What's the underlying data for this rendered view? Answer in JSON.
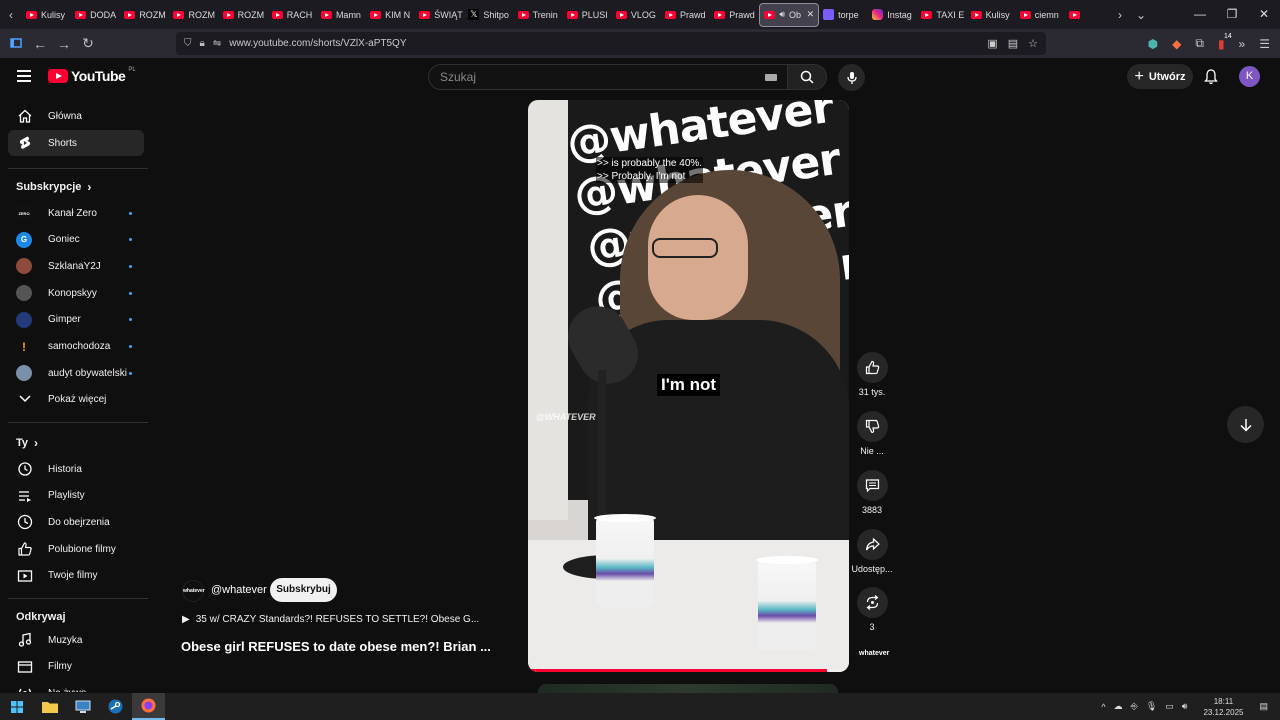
{
  "browser": {
    "tabs": [
      {
        "label": "Kulisy",
        "icon": "youtube"
      },
      {
        "label": "DODA",
        "icon": "youtube"
      },
      {
        "label": "ROZM",
        "icon": "youtube"
      },
      {
        "label": "ROZM",
        "icon": "youtube"
      },
      {
        "label": "ROZM",
        "icon": "youtube"
      },
      {
        "label": "RACH",
        "icon": "youtube"
      },
      {
        "label": "Mamn",
        "icon": "youtube"
      },
      {
        "label": "KIM N",
        "icon": "youtube"
      },
      {
        "label": "ŚWIĄT",
        "icon": "youtube"
      },
      {
        "label": "Shitpo",
        "icon": "x"
      },
      {
        "label": "Trenin",
        "icon": "youtube"
      },
      {
        "label": "PLUSI",
        "icon": "youtube"
      },
      {
        "label": "VLOG",
        "icon": "youtube"
      },
      {
        "label": "Prawd",
        "icon": "youtube"
      },
      {
        "label": "Prawd",
        "icon": "youtube"
      },
      {
        "label": "Ob",
        "icon": "youtube",
        "active": true
      },
      {
        "label": "torpe",
        "icon": "t"
      },
      {
        "label": "Instag",
        "icon": "instagram"
      },
      {
        "label": "TAXI E",
        "icon": "youtube"
      },
      {
        "label": "Kulisy",
        "icon": "youtube"
      },
      {
        "label": "ciemn",
        "icon": "youtube"
      },
      {
        "label": "",
        "icon": "youtube"
      }
    ],
    "url": "www.youtube.com/shorts/VZlX-aPT5QY",
    "extension_badge": "14"
  },
  "header": {
    "logo_text": "YouTube",
    "logo_country": "PL",
    "search_placeholder": "Szukaj",
    "create_label": "Utwórz",
    "avatar_letter": "K"
  },
  "sidebar": {
    "main": [
      {
        "label": "Główna",
        "icon": "home-icon"
      },
      {
        "label": "Shorts",
        "icon": "shorts-icon",
        "active": true
      }
    ],
    "subscriptions_title": "Subskrypcje",
    "subscriptions": [
      {
        "label": "Kanał Zero",
        "avatar": "ZERO",
        "color": "#111111"
      },
      {
        "label": "Goniec",
        "avatar": "G",
        "color": "#1e88e5"
      },
      {
        "label": "SzklanaY2J",
        "avatar": "",
        "color": "#8d4b3c"
      },
      {
        "label": "Konopskyy",
        "avatar": "",
        "color": "#555555"
      },
      {
        "label": "Gimper",
        "avatar": "",
        "color": "#243a7a"
      },
      {
        "label": "samochodoza",
        "avatar": "!",
        "color": "#f2a900"
      },
      {
        "label": "audyt obywatelski",
        "avatar": "",
        "color": "#7a8fa8"
      }
    ],
    "show_more": "Pokaż więcej",
    "you_title": "Ty",
    "you_items": [
      {
        "label": "Historia",
        "icon": "history-icon"
      },
      {
        "label": "Playlisty",
        "icon": "playlist-icon"
      },
      {
        "label": "Do obejrzenia",
        "icon": "watch-later-icon"
      },
      {
        "label": "Polubione filmy",
        "icon": "liked-icon"
      },
      {
        "label": "Twoje filmy",
        "icon": "your-videos-icon"
      }
    ],
    "explore_title": "Odkrywaj",
    "explore_items": [
      {
        "label": "Muzyka",
        "icon": "music-icon"
      },
      {
        "label": "Filmy",
        "icon": "movies-icon"
      },
      {
        "label": "Na żywo",
        "icon": "live-icon"
      }
    ]
  },
  "short": {
    "caption_top_line1": ">> is probably the 40%.",
    "caption_top_line2": ">> Probably. I'm not",
    "caption_center": "I'm not",
    "video_watermark": "@WHATEVER",
    "wall_text": "@whatever",
    "progress": 0.93,
    "channel_avatar_text": "whatever",
    "channel_handle": "@whatever",
    "subscribe_label": "Subskrybuj",
    "playlist_text": "35 w/ CRAZY Standards?! REFUSES TO SETTLE?! Obese G...",
    "title": "Obese girl REFUSES to date obese men?! Brian ...",
    "actions": {
      "likes": "31 tys.",
      "dislike_label": "Nie ...",
      "comments": "3883",
      "share_label": "Udostęp...",
      "remix": "3"
    },
    "channel_small_text": "whatever"
  },
  "taskbar": {
    "time": "18:11",
    "date": "23.12.2025"
  }
}
